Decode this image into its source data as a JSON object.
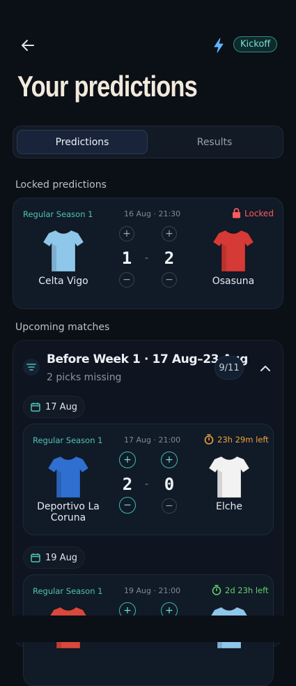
{
  "header": {
    "kickoff_label": "Kickoff"
  },
  "page": {
    "title": "Your predictions"
  },
  "tabs": [
    {
      "label": "Predictions",
      "active": true
    },
    {
      "label": "Results",
      "active": false
    }
  ],
  "locked_section": {
    "label": "Locked predictions",
    "match": {
      "league": "Regular Season 1",
      "datetime": "16 Aug · 21:30",
      "status": "Locked",
      "home": {
        "name": "Celta Vigo",
        "score": "1",
        "shirt_color": "#8fc7ea"
      },
      "away": {
        "name": "Osasuna",
        "score": "2",
        "shirt_color": "#d63a36"
      },
      "separator": "-"
    }
  },
  "upcoming_section": {
    "label": "Upcoming matches",
    "group": {
      "title": "Before Week 1 · 17 Aug–23 Aug",
      "subtitle": "2 picks missing",
      "progress": "9/11",
      "dates": [
        {
          "label": "17 Aug",
          "match": {
            "league": "Regular Season 1",
            "datetime": "17 Aug · 21:00",
            "countdown": "23h 29m left",
            "countdown_color": "#f0a43a",
            "home": {
              "name": "Deportivo La Coruna",
              "score": "2",
              "shirt_color": "#2f6fd0"
            },
            "away": {
              "name": "Elche",
              "score": "0",
              "shirt_color": "#f2f2f2"
            },
            "separator": "-"
          }
        },
        {
          "label": "19 Aug",
          "match": {
            "league": "Regular Season 1",
            "datetime": "19 Aug · 21:00",
            "countdown": "2d 23h left",
            "countdown_color": "#5fd36a",
            "home": {
              "shirt_color": "#d9483a"
            },
            "away": {
              "shirt_color": "#8fc7ea"
            }
          }
        }
      ]
    }
  },
  "colors": {
    "accent": "#3bbfae",
    "background": "#0b0f16",
    "card": "#111a27",
    "locked": "#ff5b5b"
  }
}
